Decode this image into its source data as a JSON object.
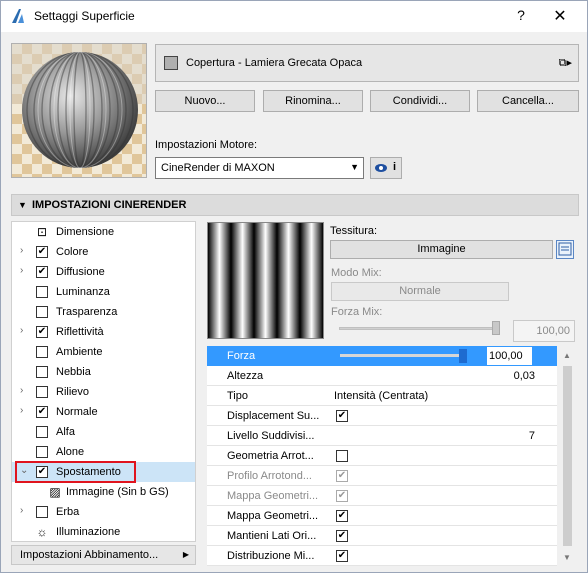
{
  "window": {
    "title": "Settaggi Superficie",
    "help": "?",
    "close": "✕"
  },
  "material": {
    "name": "Copertura - Lamiera Grecata Opaca"
  },
  "buttons": {
    "new": "Nuovo...",
    "rename": "Rinomina...",
    "share": "Condividi...",
    "delete": "Cancella..."
  },
  "engine": {
    "label": "Impostazioni Motore:",
    "value": "CineRender di MAXON",
    "info": "i"
  },
  "section": {
    "title": "IMPOSTAZIONI CINERENDER"
  },
  "tree": [
    {
      "label": "Dimensione",
      "expander": "",
      "checkbox": "none",
      "icon": "dimension-icon"
    },
    {
      "label": "Colore",
      "expander": "›",
      "checkbox": "checked"
    },
    {
      "label": "Diffusione",
      "expander": "›",
      "checkbox": "checked"
    },
    {
      "label": "Luminanza",
      "expander": "",
      "checkbox": "unchecked"
    },
    {
      "label": "Trasparenza",
      "expander": "",
      "checkbox": "unchecked"
    },
    {
      "label": "Riflettività",
      "expander": "›",
      "checkbox": "checked"
    },
    {
      "label": "Ambiente",
      "expander": "",
      "checkbox": "unchecked"
    },
    {
      "label": "Nebbia",
      "expander": "",
      "checkbox": "unchecked"
    },
    {
      "label": "Rilievo",
      "expander": "›",
      "checkbox": "unchecked"
    },
    {
      "label": "Normale",
      "expander": "›",
      "checkbox": "checked"
    },
    {
      "label": "Alfa",
      "expander": "",
      "checkbox": "unchecked"
    },
    {
      "label": "Alone",
      "expander": "",
      "checkbox": "unchecked"
    },
    {
      "label": "Spostamento",
      "expander": "⌄",
      "checkbox": "checked",
      "selected": true
    },
    {
      "label": "Immagine (Sin b GS)",
      "expander": "",
      "checkbox": "none",
      "icon": "image-icon",
      "child": true
    },
    {
      "label": "Erba",
      "expander": "›",
      "checkbox": "unchecked"
    },
    {
      "label": "Illuminazione",
      "expander": "",
      "checkbox": "none",
      "icon": "lamp-icon"
    }
  ],
  "match_dropdown": {
    "label": "Impostazioni Abbinamento..."
  },
  "texture": {
    "label": "Tessitura:",
    "button": "Immagine",
    "mode_label": "Modo Mix:",
    "mode_value": "Normale",
    "strength_label": "Forza Mix:",
    "strength_value": "100,00"
  },
  "props": [
    {
      "key": "Forza",
      "value": "100,00",
      "type": "slider",
      "level": 1.0
    },
    {
      "key": "Altezza",
      "value": "0,03",
      "type": "right"
    },
    {
      "key": "Tipo",
      "value": "Intensità (Centrata)",
      "type": "text"
    },
    {
      "key": "Displacement Su...",
      "value": "",
      "type": "check",
      "checked": true
    },
    {
      "key": "Livello Suddivisi...",
      "value": "7",
      "type": "right"
    },
    {
      "key": "Geometria Arrot...",
      "value": "",
      "type": "check",
      "checked": false
    },
    {
      "key": "Profilo Arrotond...",
      "value": "",
      "type": "check",
      "checked": true,
      "disabled": true
    },
    {
      "key": "Mappa Geometri...",
      "value": "",
      "type": "check",
      "checked": true,
      "disabled": true
    },
    {
      "key": "Mappa Geometri...",
      "value": "",
      "type": "check",
      "checked": true
    },
    {
      "key": "Mantieni Lati Ori...",
      "value": "",
      "type": "check",
      "checked": true
    },
    {
      "key": "Distribuzione Mi...",
      "value": "",
      "type": "check",
      "checked": true
    }
  ]
}
